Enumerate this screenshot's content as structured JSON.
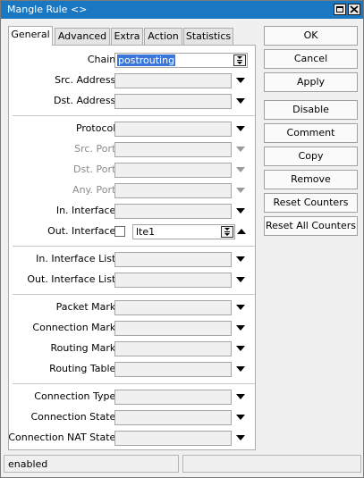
{
  "window": {
    "title": "Mangle Rule <>"
  },
  "tabs": [
    "General",
    "Advanced",
    "Extra",
    "Action",
    "Statistics"
  ],
  "fields": {
    "chain": {
      "label": "Chain:",
      "value": "postrouting"
    },
    "src_address": "Src. Address:",
    "dst_address": "Dst. Address:",
    "protocol": "Protocol:",
    "src_port": "Src. Port:",
    "dst_port": "Dst. Port:",
    "any_port": "Any. Port:",
    "in_interface": "In. Interface:",
    "out_interface": {
      "label": "Out. Interface:",
      "value": "lte1"
    },
    "in_interface_list": "In. Interface List:",
    "out_interface_list": "Out. Interface List:",
    "packet_mark": "Packet Mark:",
    "connection_mark": "Connection Mark:",
    "routing_mark": "Routing Mark:",
    "routing_table": "Routing Table:",
    "connection_type": "Connection Type:",
    "connection_state": "Connection State:",
    "connection_nat_state": "Connection NAT State:"
  },
  "buttons": {
    "ok": "OK",
    "cancel": "Cancel",
    "apply": "Apply",
    "disable": "Disable",
    "comment": "Comment",
    "copy": "Copy",
    "remove": "Remove",
    "reset_counters": "Reset Counters",
    "reset_all_counters": "Reset All Counters"
  },
  "status": {
    "left": "enabled",
    "right": ""
  }
}
